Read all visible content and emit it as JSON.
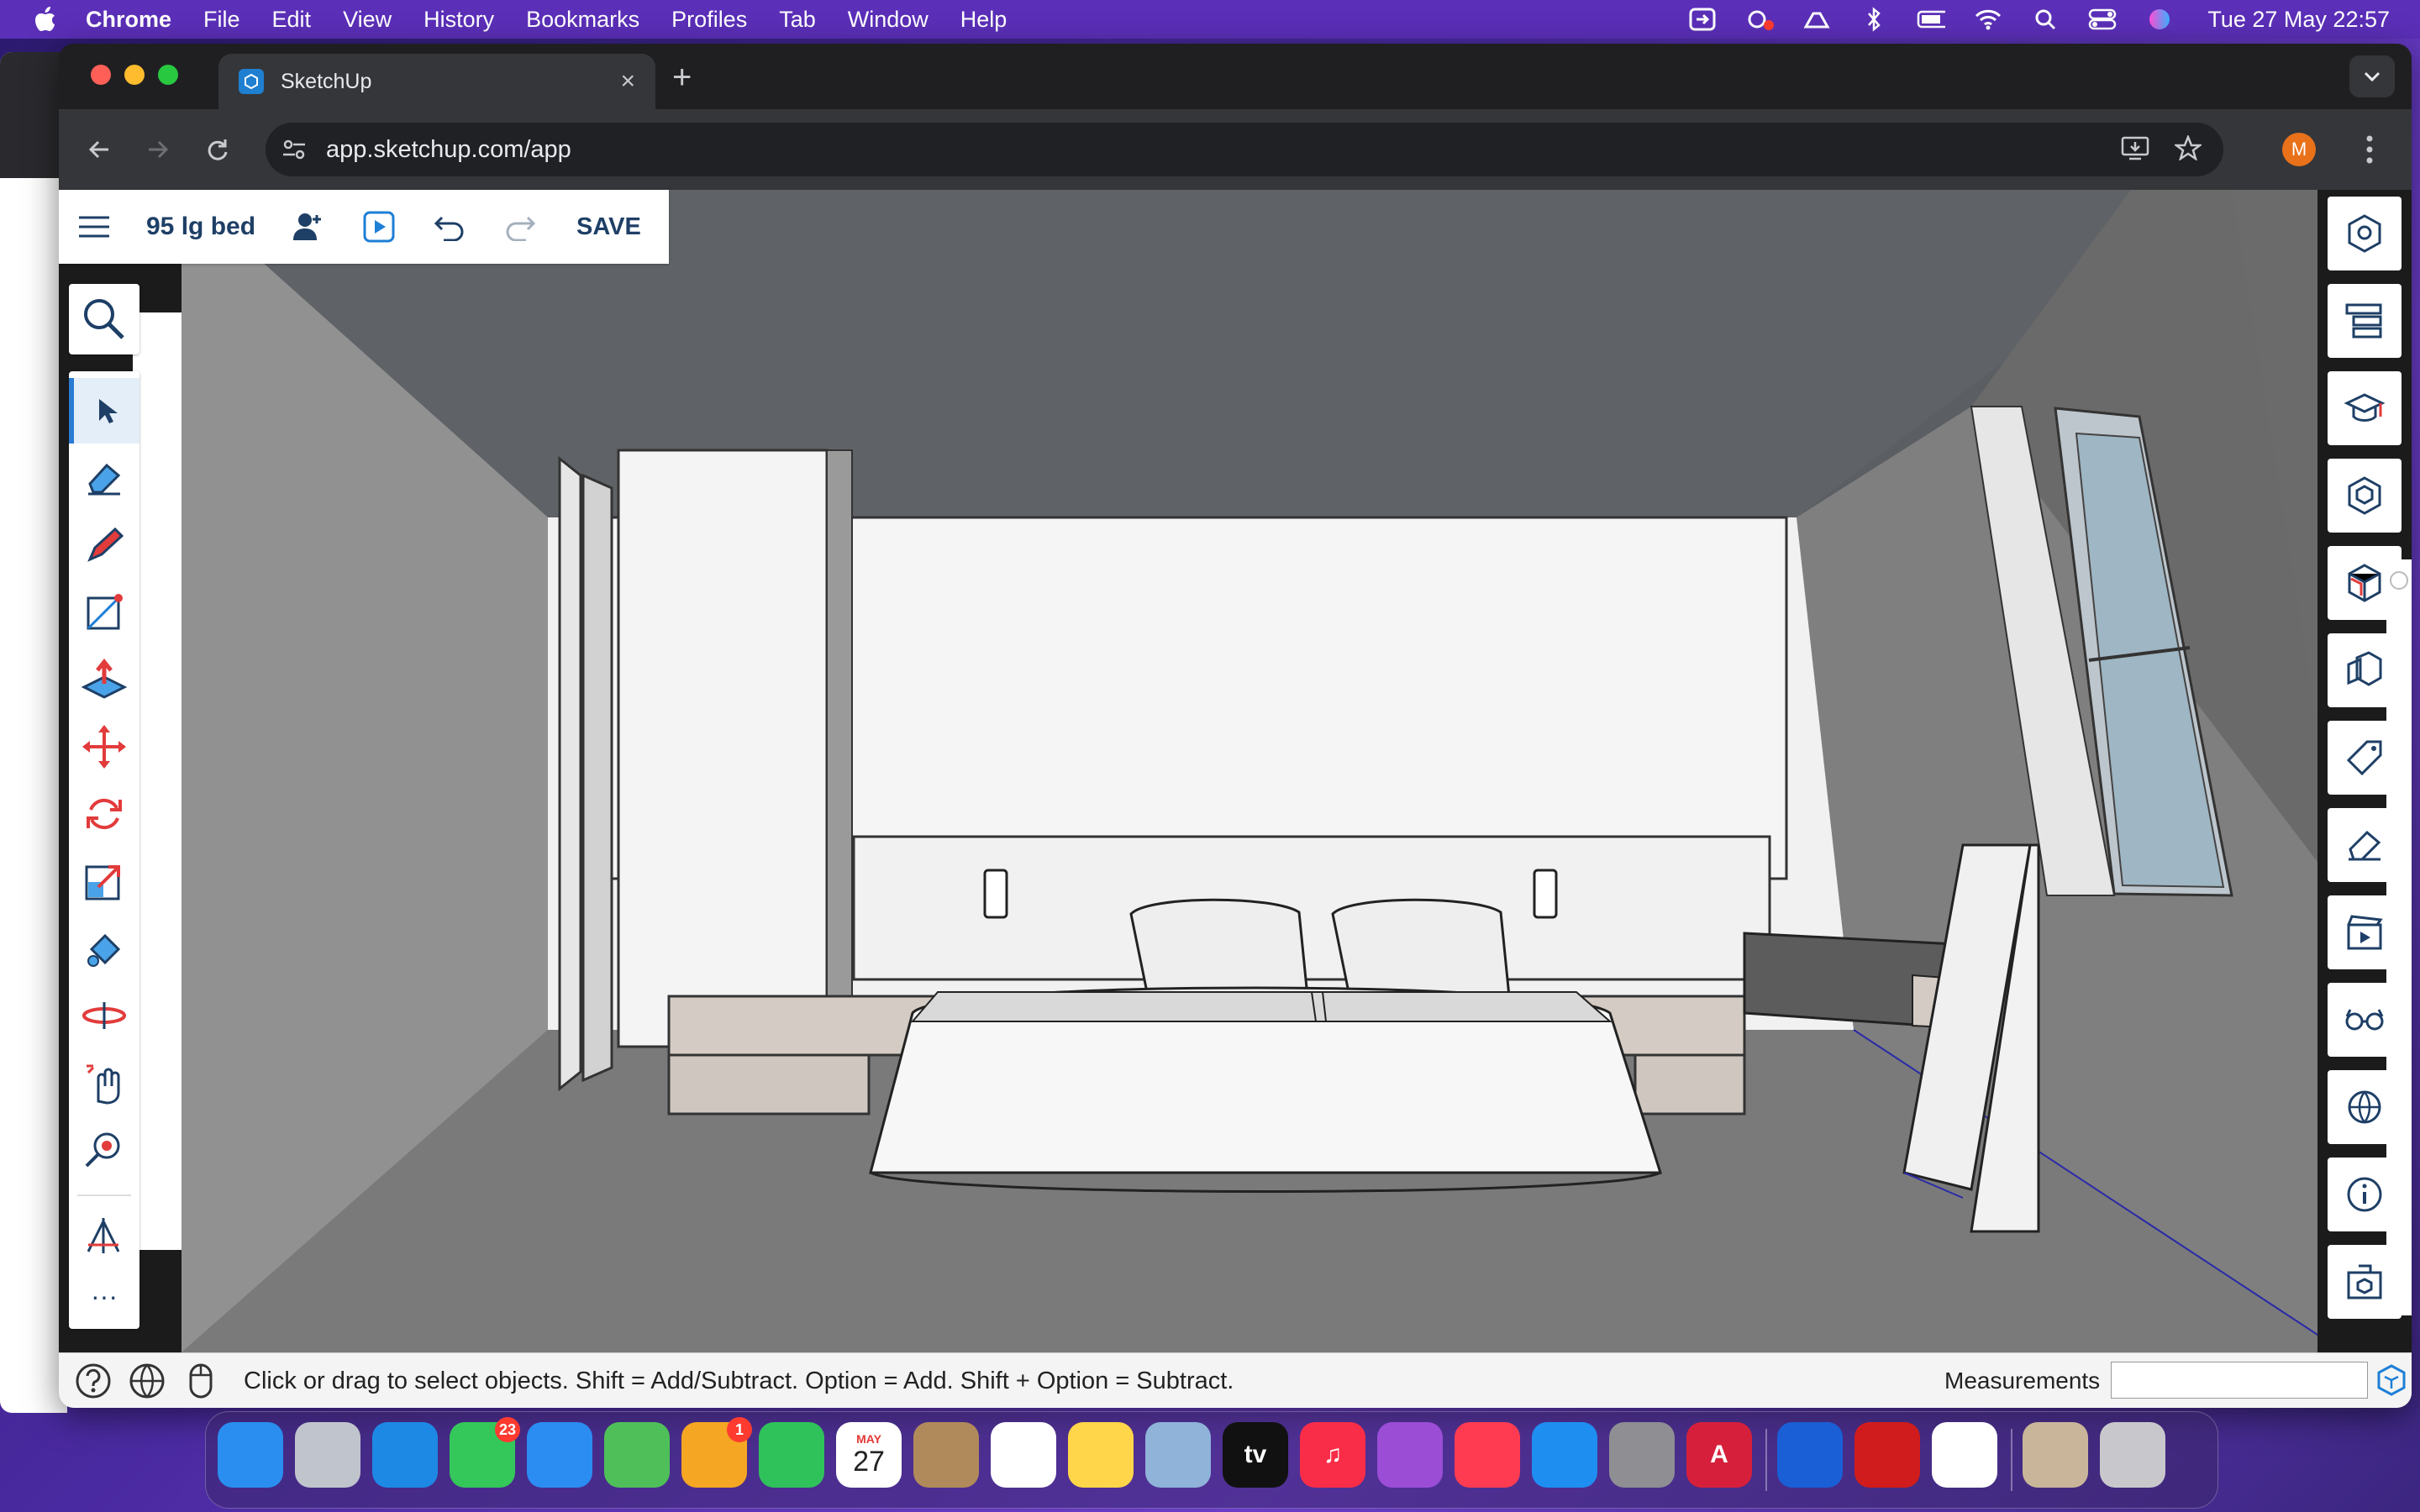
{
  "menubar": {
    "app_name": "Chrome",
    "items": [
      "File",
      "Edit",
      "View",
      "History",
      "Bookmarks",
      "Profiles",
      "Tab",
      "Window",
      "Help"
    ],
    "clock": "Tue 27 May  22:57"
  },
  "browser": {
    "tab_title": "SketchUp",
    "url": "app.sketchup.com/app",
    "profile_initial": "M"
  },
  "sketchup": {
    "model_name": "95 lg bed",
    "save_label": "SAVE",
    "status_text": "Click or drag to select objects. Shift = Add/Subtract. Option = Add. Shift + Option = Subtract.",
    "measurements_label": "Measurements",
    "measurements_value": "",
    "tools": [
      "select",
      "eraser",
      "pencil",
      "rectangle",
      "push-pull",
      "move",
      "rotate",
      "scale",
      "paint-bucket",
      "orbit",
      "pan",
      "zoom-extents",
      "section-plane",
      "more"
    ],
    "active_tool": "select",
    "more_label": "···",
    "right_panel": [
      "entity-info",
      "outliner",
      "instructor",
      "components",
      "materials",
      "styles",
      "tags",
      "scenes",
      "display",
      "shadows",
      "model-info",
      "3d-warehouse"
    ]
  },
  "dock": {
    "apps": [
      {
        "name": "Finder",
        "color": "#2a8ef0",
        "label": ""
      },
      {
        "name": "Launchpad",
        "color": "#c0c4cc",
        "label": ""
      },
      {
        "name": "Safari",
        "color": "#1e88e5",
        "label": ""
      },
      {
        "name": "Messages",
        "color": "#34c759",
        "label": "",
        "badge": "23"
      },
      {
        "name": "Mail",
        "color": "#2b8cf2",
        "label": ""
      },
      {
        "name": "Maps",
        "color": "#4fbf5a",
        "label": ""
      },
      {
        "name": "Photos",
        "color": "#f5a623",
        "label": "",
        "badge": "1"
      },
      {
        "name": "FaceTime",
        "color": "#2fc25b",
        "label": ""
      },
      {
        "name": "Calendar",
        "color": "#ffffff",
        "label": "27",
        "month": "MAY"
      },
      {
        "name": "Contacts",
        "color": "#b08a5a",
        "label": ""
      },
      {
        "name": "Reminders",
        "color": "#ffffff",
        "label": ""
      },
      {
        "name": "Notes",
        "color": "#ffd54a",
        "label": ""
      },
      {
        "name": "Preview",
        "color": "#8fb3d9",
        "label": ""
      },
      {
        "name": "Apple TV",
        "color": "#111111",
        "label": "tv"
      },
      {
        "name": "Music",
        "color": "#fa2d48",
        "label": "♫"
      },
      {
        "name": "Podcasts",
        "color": "#9b4dd6",
        "label": ""
      },
      {
        "name": "News",
        "color": "#ff3b52",
        "label": ""
      },
      {
        "name": "App Store",
        "color": "#1f8ef1",
        "label": ""
      },
      {
        "name": "System Settings",
        "color": "#8e8e93",
        "label": ""
      },
      {
        "name": "AutoCAD",
        "color": "#d6203b",
        "label": "A"
      },
      {
        "name": "1Password",
        "color": "#1a5fd6",
        "label": ""
      },
      {
        "name": "Acrobat",
        "color": "#d01c1c",
        "label": ""
      },
      {
        "name": "Chrome",
        "color": "#ffffff",
        "label": ""
      },
      {
        "name": "Recent document",
        "color": "#c9b59a",
        "label": ""
      },
      {
        "name": "Trash",
        "color": "#c8c8cc",
        "label": ""
      }
    ]
  }
}
